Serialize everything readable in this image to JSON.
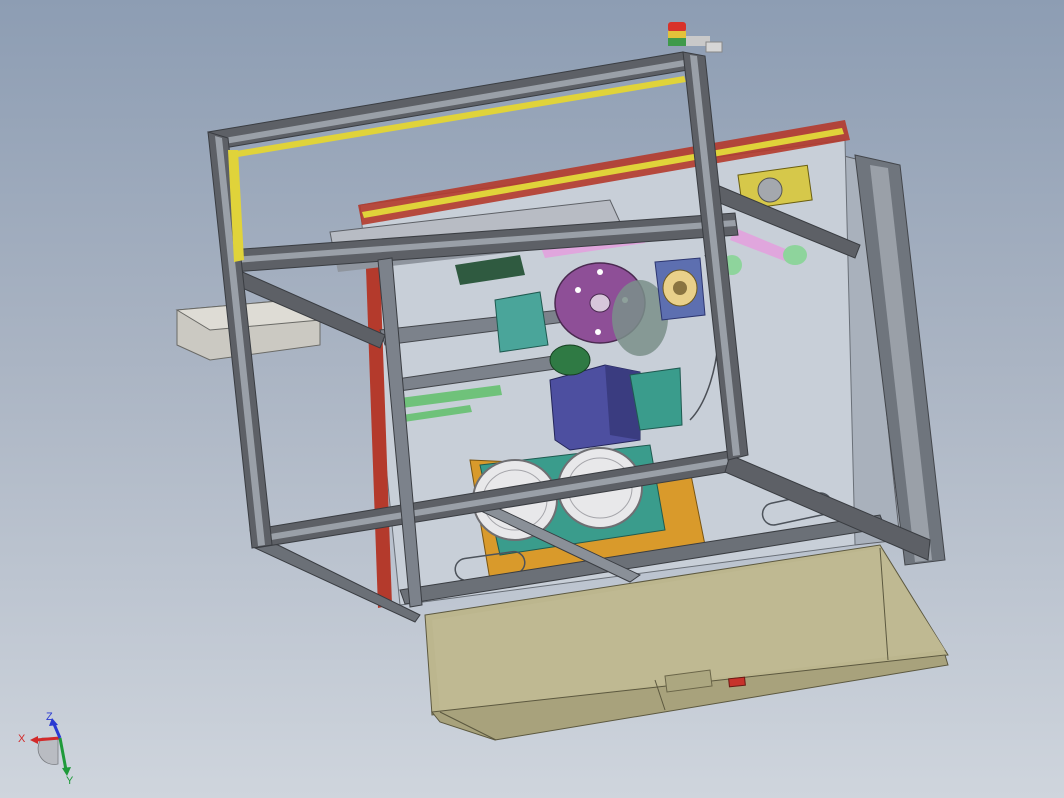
{
  "app": {
    "view": "isometric-3d-model"
  },
  "colors": {
    "background_top": "#8d9db3",
    "background_bottom": "#cfd5dd",
    "frame": "#5d6066",
    "frame_highlight": "#9aa0a8",
    "base_cabinet": "#bcb68e",
    "back_panel": "#c8cfd8",
    "purple_disc": "#8e4f97",
    "blue_box": "#4d4fa0",
    "teal_part": "#3a9c8c",
    "orange_plate": "#d99a2b",
    "yellow_trim": "#e0d33a",
    "red_trim": "#b43a2c",
    "stack_light_red": "#d8322a",
    "stack_light_yellow": "#e3c23a",
    "stack_light_green": "#3f9a4a",
    "axis_x": "#d22a2a",
    "axis_y": "#1f9a3a",
    "axis_z": "#2a3ad2"
  },
  "triad": {
    "x_label": "X",
    "y_label": "Y",
    "z_label": "Z",
    "icon": "coordinate-triad-icon"
  }
}
